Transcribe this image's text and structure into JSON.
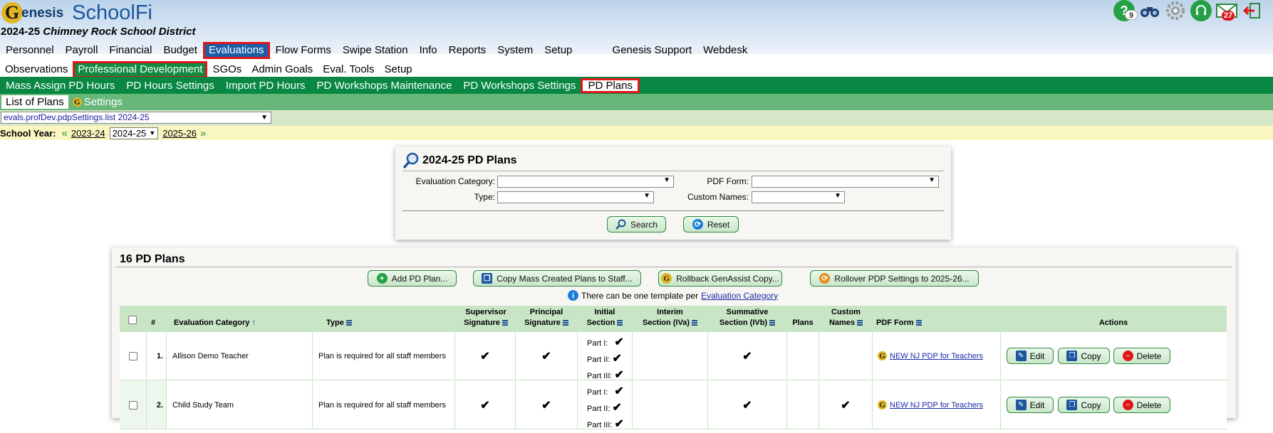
{
  "app": {
    "brand_g": "G",
    "brand_enesis": "enesis",
    "brand_name": "SchoolFi"
  },
  "district": {
    "year": "2024-25",
    "name": "Chimney Rock School District"
  },
  "header_icons": {
    "help_badge": "9",
    "mail_badge": "27"
  },
  "top_menu": [
    "Personnel",
    "Payroll",
    "Financial",
    "Budget",
    "Evaluations",
    "Flow Forms",
    "Swipe Station",
    "Info",
    "Reports",
    "System",
    "Setup",
    "Genesis Support",
    "Webdesk"
  ],
  "top_menu_active": "Evaluations",
  "sub_menu": [
    "Observations",
    "Professional Development",
    "SGOs",
    "Admin Goals",
    "Eval. Tools",
    "Setup"
  ],
  "pd_menu": [
    "Mass Assign PD Hours",
    "PD Hours Settings",
    "Import PD Hours",
    "PD Workshops Maintenance",
    "PD Workshops Settings",
    "PD Plans"
  ],
  "tabs": {
    "list": "List of Plans",
    "settings": "Settings"
  },
  "path_select": "evals.profDev.pdpSettings.list 2024-25",
  "school_year": {
    "label": "School Year:",
    "prev": "2023-24",
    "current": "2024-25",
    "next": "2025-26"
  },
  "search": {
    "title": "2024-25 PD Plans",
    "eval_category_label": "Evaluation Category:",
    "pdf_form_label": "PDF Form:",
    "type_label": "Type:",
    "custom_names_label": "Custom Names:",
    "search_button": "Search",
    "reset_button": "Reset"
  },
  "plans": {
    "title": "16 PD Plans",
    "add_button": "Add PD Plan...",
    "copy_button": "Copy Mass Created Plans to Staff...",
    "rollback_button": "Rollback GenAssist Copy...",
    "rollover_button": "Rollover PDP Settings to 2025-26...",
    "info_note": "There can be one template per",
    "info_link": "Evaluation Category"
  },
  "table": {
    "headers": {
      "num": "#",
      "eval_category": "Evaluation Category",
      "type": "Type",
      "supervisor_1": "Supervisor",
      "supervisor_2": "Signature",
      "principal_1": "Principal",
      "principal_2": "Signature",
      "initial_1": "Initial",
      "initial_2": "Section",
      "interim_1": "Interim",
      "interim_2": "Section (IVa)",
      "summative_1": "Summative",
      "summative_2": "Section (IVb)",
      "plans": "Plans",
      "custom_1": "Custom",
      "custom_2": "Names",
      "pdf_form": "PDF Form",
      "actions": "Actions"
    },
    "part_labels": [
      "Part I:",
      "Part II:",
      "Part III:"
    ],
    "rows": [
      {
        "num": "1.",
        "category": "Allison Demo Teacher",
        "type": "Plan is required for all staff members",
        "supervisor": true,
        "principal": true,
        "summative": true,
        "custom_names": false,
        "pdf_form": "NEW NJ PDP for Teachers"
      },
      {
        "num": "2.",
        "category": "Child Study Team",
        "type": "Plan is required for all staff members",
        "supervisor": true,
        "principal": true,
        "summative": true,
        "custom_names": true,
        "pdf_form": "NEW NJ PDP for Teachers"
      }
    ],
    "action_labels": {
      "edit": "Edit",
      "copy": "Copy",
      "delete": "Delete"
    },
    "check_glyph": "✔"
  },
  "colors": {
    "menu_active": "#1b5ea5",
    "green_bar": "#088843",
    "highlight_border": "#e0161b"
  }
}
